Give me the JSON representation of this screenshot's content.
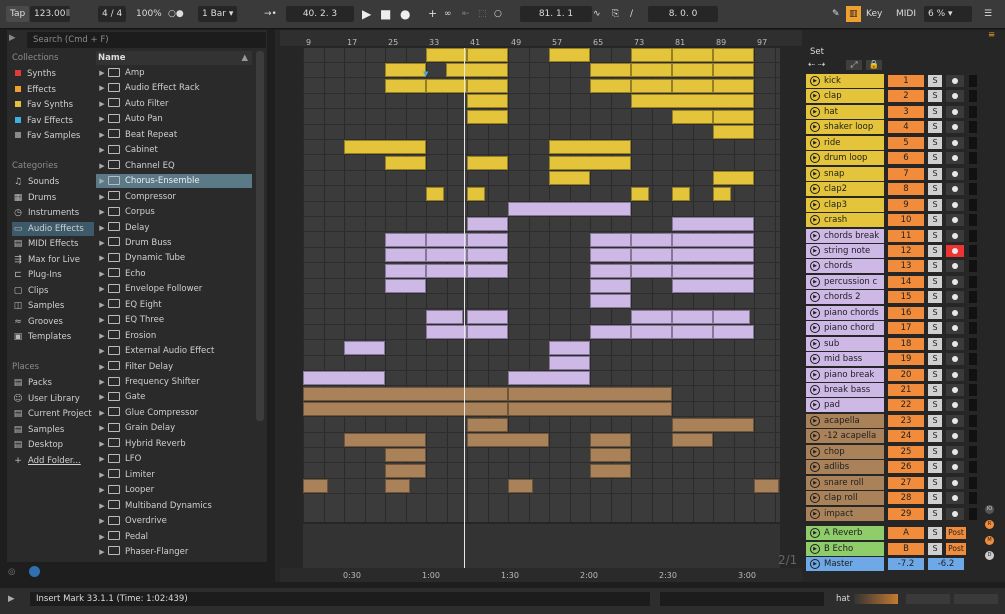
{
  "topbar": {
    "tap": "Tap",
    "tempo": "123.00",
    "sig": "4 / 4",
    "zoom": "100%",
    "quant": "1 Bar",
    "pos": "40.  2.  3",
    "loop_start": "81.  1.  1",
    "loop_len": "8.  0.  0",
    "key": "Key",
    "midi": "MIDI",
    "cpu": "6 %"
  },
  "browser": {
    "search_placeholder": "Search (Cmd + F)",
    "collections_header": "Collections",
    "collections": [
      {
        "label": "Synths",
        "color": "#e03a3a"
      },
      {
        "label": "Effects",
        "color": "#f0a030"
      },
      {
        "label": "Fav Synths",
        "color": "#e0c040"
      },
      {
        "label": "Fav Effects",
        "color": "#40b0e0"
      },
      {
        "label": "Fav Samples",
        "color": "#8a8a8a"
      }
    ],
    "categories_header": "Categories",
    "categories": [
      {
        "label": "Sounds",
        "icon": "sounds-icon"
      },
      {
        "label": "Drums",
        "icon": "drums-icon"
      },
      {
        "label": "Instruments",
        "icon": "instruments-icon"
      },
      {
        "label": "Audio Effects",
        "icon": "audio-effects-icon"
      },
      {
        "label": "MIDI Effects",
        "icon": "midi-effects-icon"
      },
      {
        "label": "Max for Live",
        "icon": "max-icon"
      },
      {
        "label": "Plug-Ins",
        "icon": "plugin-icon"
      },
      {
        "label": "Clips",
        "icon": "clips-icon"
      },
      {
        "label": "Samples",
        "icon": "samples-icon"
      },
      {
        "label": "Grooves",
        "icon": "grooves-icon"
      },
      {
        "label": "Templates",
        "icon": "templates-icon"
      }
    ],
    "places_header": "Places",
    "places": [
      {
        "label": "Packs"
      },
      {
        "label": "User Library"
      },
      {
        "label": "Current Project"
      },
      {
        "label": "Samples"
      },
      {
        "label": "Desktop"
      },
      {
        "label": "Add Folder..."
      }
    ],
    "name_header": "Name",
    "items": [
      "Amp",
      "Audio Effect Rack",
      "Auto Filter",
      "Auto Pan",
      "Beat Repeat",
      "Cabinet",
      "Channel EQ",
      "Chorus-Ensemble",
      "Compressor",
      "Corpus",
      "Delay",
      "Drum Buss",
      "Dynamic Tube",
      "Echo",
      "Envelope Follower",
      "EQ Eight",
      "EQ Three",
      "Erosion",
      "External Audio Effect",
      "Filter Delay",
      "Frequency Shifter",
      "Gate",
      "Glue Compressor",
      "Grain Delay",
      "Hybrid Reverb",
      "LFO",
      "Limiter",
      "Looper",
      "Multiband Dynamics",
      "Overdrive",
      "Pedal",
      "Phaser-Flanger"
    ]
  },
  "ruler": {
    "bars": [
      "9",
      "17",
      "25",
      "33",
      "41",
      "49",
      "57",
      "65",
      "73",
      "81",
      "89",
      "97"
    ],
    "times": [
      "0:30",
      "1:00",
      "1:30",
      "2:00",
      "2:30",
      "3:00"
    ],
    "set": "Set"
  },
  "tracks": [
    {
      "name": "kick",
      "num": "1",
      "color": "#e3c43a"
    },
    {
      "name": "clap",
      "num": "2",
      "color": "#e3c43a"
    },
    {
      "name": "hat",
      "num": "3",
      "color": "#e3c43a"
    },
    {
      "name": "shaker loop",
      "num": "4",
      "color": "#e3c43a"
    },
    {
      "name": "ride",
      "num": "5",
      "color": "#e3c43a"
    },
    {
      "name": "drum loop",
      "num": "6",
      "color": "#e3c43a"
    },
    {
      "name": "snap",
      "num": "7",
      "color": "#e3c43a"
    },
    {
      "name": "clap2",
      "num": "8",
      "color": "#e3c43a"
    },
    {
      "name": "clap3",
      "num": "9",
      "color": "#e3c43a"
    },
    {
      "name": "crash",
      "num": "10",
      "color": "#e3c43a"
    },
    {
      "name": "chords break",
      "num": "11",
      "color": "#cdb8e6"
    },
    {
      "name": "string note",
      "num": "12",
      "color": "#cdb8e6"
    },
    {
      "name": "chords",
      "num": "13",
      "color": "#cdb8e6"
    },
    {
      "name": "percussion c",
      "num": "14",
      "color": "#cdb8e6"
    },
    {
      "name": "chords 2",
      "num": "15",
      "color": "#cdb8e6"
    },
    {
      "name": "piano chords",
      "num": "16",
      "color": "#cdb8e6"
    },
    {
      "name": "piano chord",
      "num": "17",
      "color": "#cdb8e6"
    },
    {
      "name": "sub",
      "num": "18",
      "color": "#cdb8e6"
    },
    {
      "name": "mid bass",
      "num": "19",
      "color": "#cdb8e6"
    },
    {
      "name": "piano break",
      "num": "20",
      "color": "#cdb8e6"
    },
    {
      "name": "break bass",
      "num": "21",
      "color": "#cdb8e6"
    },
    {
      "name": "pad",
      "num": "22",
      "color": "#cdb8e6"
    },
    {
      "name": "acapella",
      "num": "23",
      "color": "#a9825a"
    },
    {
      "name": "-12 acapella",
      "num": "24",
      "color": "#a9825a"
    },
    {
      "name": "chop",
      "num": "25",
      "color": "#a9825a"
    },
    {
      "name": "adlibs",
      "num": "26",
      "color": "#a9825a"
    },
    {
      "name": "snare roll",
      "num": "27",
      "color": "#a9825a"
    },
    {
      "name": "clap roll",
      "num": "28",
      "color": "#a9825a"
    },
    {
      "name": "impact",
      "num": "29",
      "color": "#a9825a"
    }
  ],
  "returns": [
    {
      "name": "A Reverb",
      "letter": "A",
      "post": "Post"
    },
    {
      "name": "B Echo",
      "letter": "B",
      "post": "Post"
    }
  ],
  "master": {
    "name": "Master",
    "vol": "-7.2",
    "pan": "-6.2"
  },
  "page_ind": "2/1",
  "status": {
    "text": "Insert Mark 33.1.1 (Time: 1:02:439)",
    "track": "hat"
  }
}
